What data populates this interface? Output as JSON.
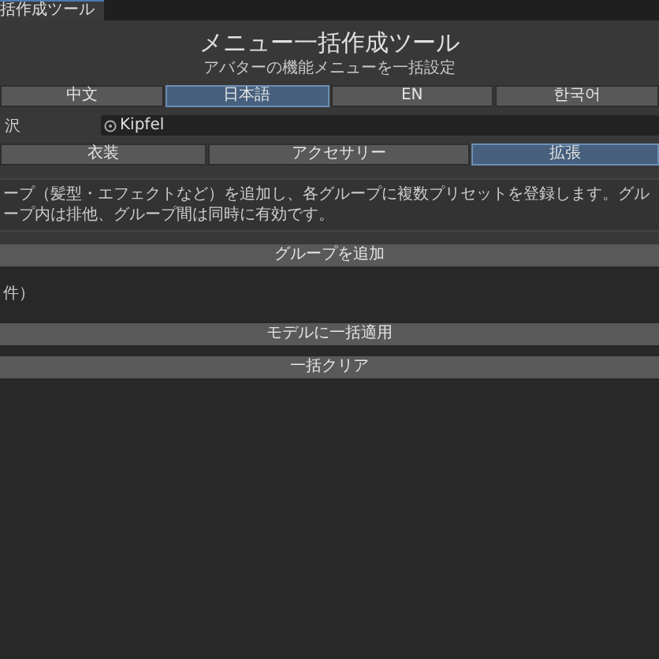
{
  "window": {
    "tab": "括作成ツール"
  },
  "header": {
    "title": "メニュー一括作成ツール",
    "subtitle": "アバターの機能メニューを一括設定"
  },
  "languages": [
    {
      "label": "中文",
      "selected": false
    },
    {
      "label": "日本語",
      "selected": true
    },
    {
      "label": "EN",
      "selected": false
    },
    {
      "label": "한국어",
      "selected": false
    }
  ],
  "avatar_field": {
    "label": "沢",
    "value": "Kipfel"
  },
  "categories": [
    {
      "label": "衣装",
      "selected": false
    },
    {
      "label": "アクセサリー",
      "selected": false
    },
    {
      "label": "拡張",
      "selected": true
    }
  ],
  "help_text": "ープ（髪型・エフェクトなど）を追加し、各グループに複数プリセットを登録します。グループ内は排他、グループ間は同時に有効です。",
  "add_group_button": "グループを追加",
  "count_text": "件）",
  "apply_button": "モデルに一括適用",
  "clear_button": "一括クリア"
}
